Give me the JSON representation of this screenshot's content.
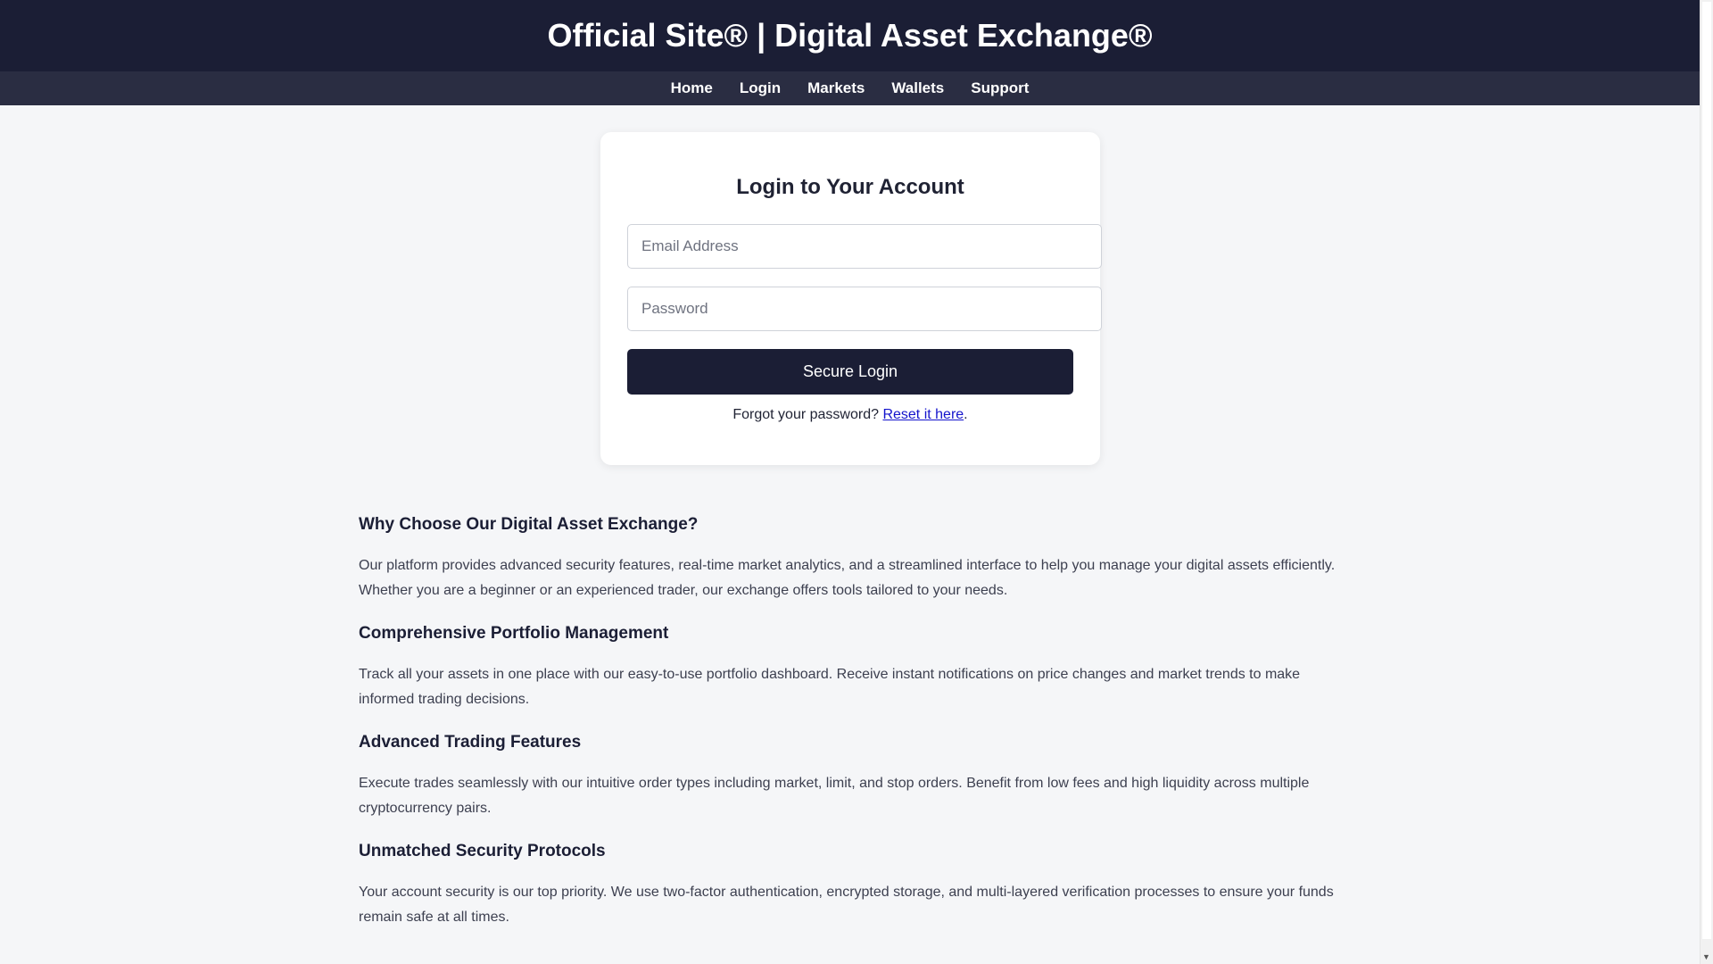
{
  "header": {
    "title": "Official Site® | Digital Asset Exchange®"
  },
  "nav": {
    "items": [
      {
        "label": "Home"
      },
      {
        "label": "Login"
      },
      {
        "label": "Markets"
      },
      {
        "label": "Wallets"
      },
      {
        "label": "Support"
      }
    ]
  },
  "login": {
    "title": "Login to Your Account",
    "email_placeholder": "Email Address",
    "email_value": "",
    "password_placeholder": "Password",
    "password_value": "",
    "submit_label": "Secure Login",
    "forgot_text": "Forgot your password?",
    "reset_link": "Reset it here",
    "forgot_suffix": "."
  },
  "sections": [
    {
      "heading": "Why Choose Our Digital Asset Exchange?",
      "body": "Our platform provides advanced security features, real-time market analytics, and a streamlined interface to help you manage your digital assets efficiently. Whether you are a beginner or an experienced trader, our exchange offers tools tailored to your needs."
    },
    {
      "heading": "Comprehensive Portfolio Management",
      "body": "Track all your assets in one place with our easy-to-use portfolio dashboard. Receive instant notifications on price changes and market trends to make informed trading decisions."
    },
    {
      "heading": "Advanced Trading Features",
      "body": "Execute trades seamlessly with our intuitive order types including market, limit, and stop orders. Benefit from low fees and high liquidity across multiple cryptocurrency pairs."
    },
    {
      "heading": "Unmatched Security Protocols",
      "body": "Your account security is our top priority. We use two-factor authentication, encrypted storage, and multi-layered verification processes to ensure your funds remain safe at all times."
    }
  ],
  "colors": {
    "header_bg": "#1b1e35",
    "nav_bg": "#2a2d42",
    "page_bg": "#f5f6f8",
    "button_bg": "#1b1e35",
    "link": "#1414cc"
  },
  "icons": {
    "scroll_down": "chevron-down-icon"
  }
}
